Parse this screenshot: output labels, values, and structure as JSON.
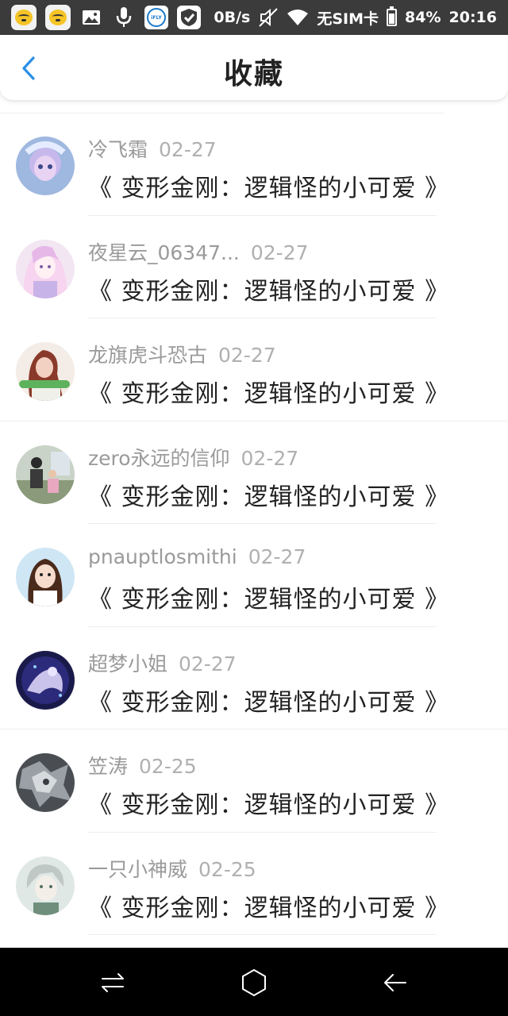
{
  "status_bar": {
    "net_speed": "0B/s",
    "carrier": "无SIM卡",
    "battery": "84%",
    "time": "20:16",
    "battery_level": 0.84,
    "icons": [
      "qq-icon",
      "qq-icon",
      "gallery-icon",
      "mic-icon",
      "ifly-icon",
      "shield-icon",
      "mute-icon",
      "wifi-icon",
      "battery-icon"
    ],
    "ifly_label": "iFLY"
  },
  "header": {
    "title": "收藏",
    "back_icon": "chevron-left-icon",
    "accent_color": "#2a8ee8"
  },
  "favorites": [
    {
      "username": "冷飞霜",
      "date": "02-27",
      "title": "《 变形金刚：逻辑怪的小可爱 》"
    },
    {
      "username": "夜星云_06347...",
      "date": "02-27",
      "title": "《 变形金刚：逻辑怪的小可爱 》"
    },
    {
      "username": "龙旗虎斗恐古",
      "date": "02-27",
      "title": "《 变形金刚：逻辑怪的小可爱 》"
    },
    {
      "username": "zero永远的信仰",
      "date": "02-27",
      "title": "《 变形金刚：逻辑怪的小可爱 》"
    },
    {
      "username": "pnauptlosmithi",
      "date": "02-27",
      "title": "《 变形金刚：逻辑怪的小可爱 》"
    },
    {
      "username": "超梦小姐",
      "date": "02-27",
      "title": "《 变形金刚：逻辑怪的小可爱 》"
    },
    {
      "username": "笠涛",
      "date": "02-25",
      "title": "《 变形金刚：逻辑怪的小可爱 》"
    },
    {
      "username": "一只小神威",
      "date": "02-25",
      "title": "《 变形金刚：逻辑怪的小可爱 》"
    }
  ],
  "nav_bar": {
    "icons": [
      "recent-apps-icon",
      "home-icon",
      "back-arrow-icon"
    ]
  }
}
